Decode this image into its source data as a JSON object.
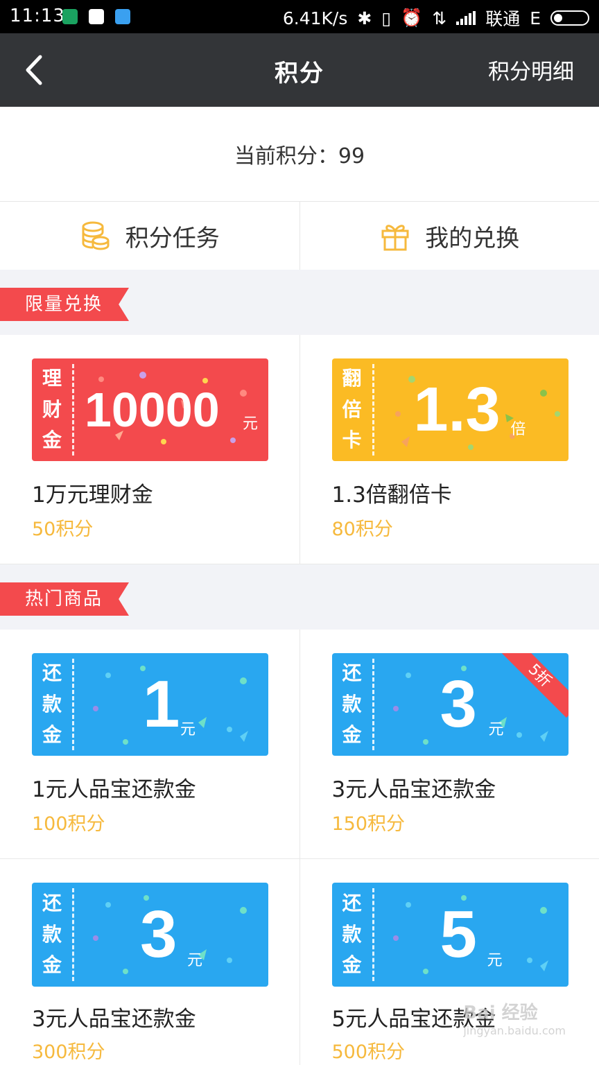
{
  "statusbar": {
    "time": "11:13",
    "speed": "6.41K/s",
    "carrier": "联通",
    "network": "E",
    "icons": [
      "shield-app-icon",
      "qq-icon",
      "message-app-icon",
      "bluetooth-icon",
      "vibrate-icon",
      "alarm-icon",
      "data-transfer-icon",
      "signal-icon",
      "battery-icon"
    ]
  },
  "header": {
    "title": "积分",
    "detail_label": "积分明细"
  },
  "points": {
    "label": "当前积分：",
    "value": "99"
  },
  "tabs": [
    {
      "label": "积分任务",
      "icon": "coins-icon"
    },
    {
      "label": "我的兑换",
      "icon": "gift-icon"
    }
  ],
  "sections": [
    {
      "title": "限量兑换",
      "items": [
        {
          "ticket_label": [
            "理",
            "财",
            "金"
          ],
          "amount": "10000",
          "unit": "元",
          "color": "#f34a4d",
          "name": "1万元理财金",
          "cost": "50积分"
        },
        {
          "ticket_label": [
            "翻",
            "倍",
            "卡"
          ],
          "amount": "1.3",
          "unit": "倍",
          "color": "#fbbb24",
          "name": "1.3倍翻倍卡",
          "cost": "80积分"
        }
      ]
    },
    {
      "title": "热门商品",
      "items": [
        {
          "ticket_label": [
            "还",
            "款",
            "金"
          ],
          "amount": "1",
          "unit": "元",
          "color": "#29a7f0",
          "name": "1元人品宝还款金",
          "cost": "100积分"
        },
        {
          "ticket_label": [
            "还",
            "款",
            "金"
          ],
          "amount": "3",
          "unit": "元",
          "color": "#29a7f0",
          "name": "3元人品宝还款金",
          "cost": "150积分",
          "badge": "5折"
        },
        {
          "ticket_label": [
            "还",
            "款",
            "金"
          ],
          "amount": "3",
          "unit": "元",
          "color": "#29a7f0",
          "name": "3元人品宝还款金",
          "cost": "300积分"
        },
        {
          "ticket_label": [
            "还",
            "款",
            "金"
          ],
          "amount": "5",
          "unit": "元",
          "color": "#29a7f0",
          "name": "5元人品宝还款金",
          "cost": "500积分"
        }
      ]
    }
  ],
  "watermark": {
    "text": "Bai 经验",
    "url": "jingyan.baidu.com"
  }
}
